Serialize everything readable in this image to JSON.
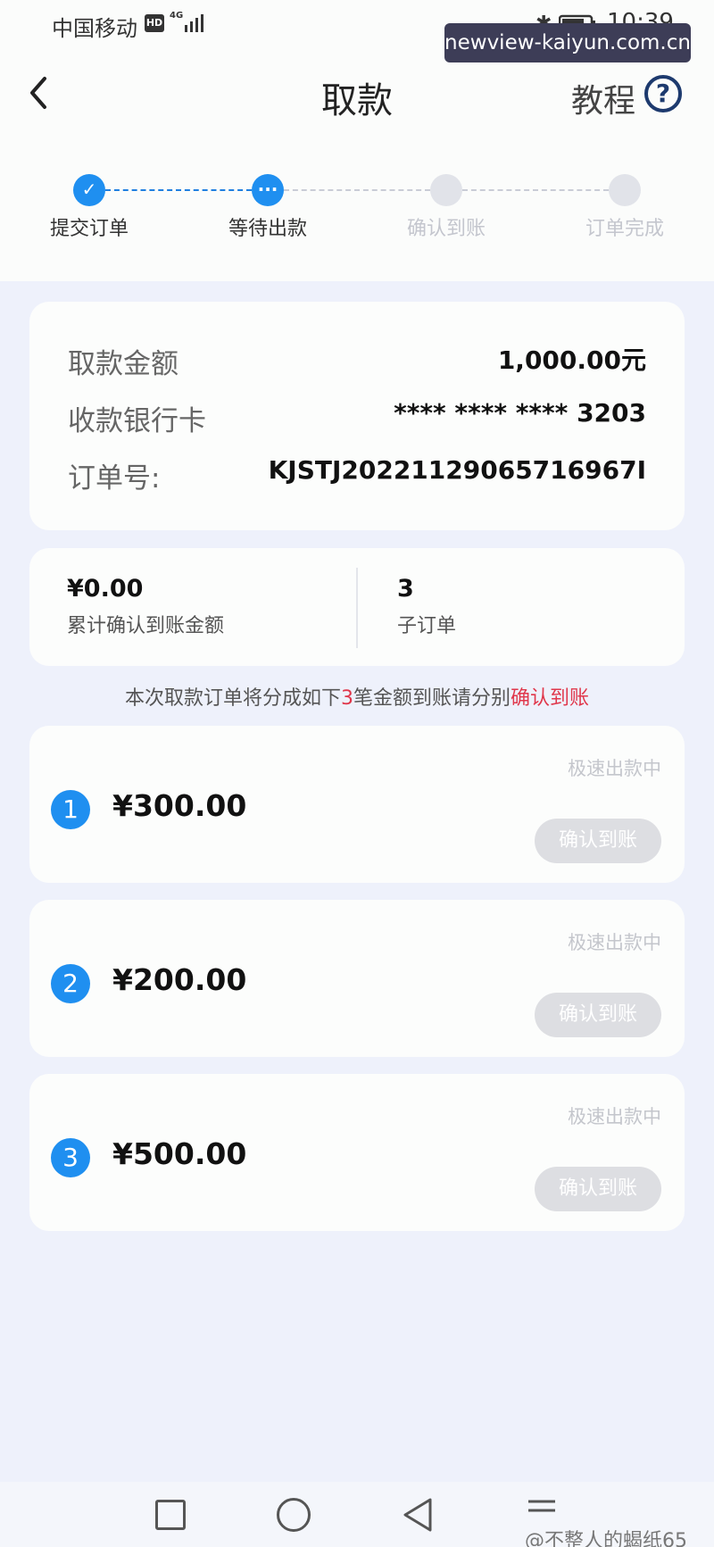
{
  "status_bar": {
    "carrier": "中国移动",
    "hd_badge": "HD",
    "network": "4G",
    "time": "10:39"
  },
  "watermark_top": "newview-kaiyun.com.cn",
  "header": {
    "title": "取款",
    "tutorial": "教程",
    "help_icon": "?"
  },
  "steps": [
    {
      "label": "提交订单",
      "state": "done",
      "icon": "✓"
    },
    {
      "label": "等待出款",
      "state": "current",
      "icon": "···"
    },
    {
      "label": "确认到账",
      "state": "pending",
      "icon": ""
    },
    {
      "label": "订单完成",
      "state": "pending",
      "icon": ""
    }
  ],
  "info": {
    "amount_label": "取款金额",
    "amount_value": "1,000.00元",
    "card_label": "收款银行卡",
    "card_value": "**** **** **** 3203",
    "order_label": "订单号:",
    "order_value": "KJSTJ20221129065716967I"
  },
  "summary": {
    "confirmed_value": "¥0.00",
    "confirmed_label": "累计确认到账金额",
    "sub_count_value": "3",
    "sub_count_label": "子订单"
  },
  "notice": {
    "prefix": "本次取款订单将分成如下",
    "count": "3",
    "middle": "笔金额到账请分别",
    "link": "确认到账"
  },
  "sub_orders": [
    {
      "num": "1",
      "amount": "¥300.00",
      "status": "极速出款中",
      "button": "确认到账"
    },
    {
      "num": "2",
      "amount": "¥200.00",
      "status": "极速出款中",
      "button": "确认到账"
    },
    {
      "num": "3",
      "amount": "¥500.00",
      "status": "极速出款中",
      "button": "确认到账"
    }
  ],
  "watermark_bottom": "@不整人的蝎纸65",
  "colors": {
    "accent": "#1f8ff0",
    "highlight": "#e0374b",
    "background": "#eef1fb",
    "disabled_button": "#dddee2"
  }
}
